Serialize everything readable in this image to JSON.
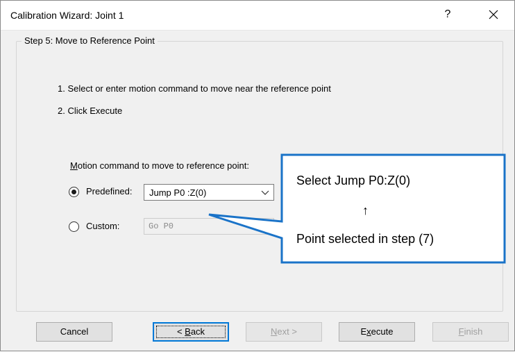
{
  "window": {
    "title": "Calibration Wizard: Joint 1",
    "help_label": "?"
  },
  "group": {
    "title": "Step 5: Move to Reference Point"
  },
  "instructions": [
    "1. Select or enter motion command to move near the reference point",
    "2. Click Execute"
  ],
  "motion": {
    "label_accesskey": "M",
    "label_rest": "otion command to move to reference point:",
    "predefined_label": "Predefined:",
    "predefined_selected": true,
    "predefined_value": "Jump P0 :Z(0)",
    "custom_label": "Custom:",
    "custom_selected": false,
    "custom_value": "Go P0"
  },
  "callout": {
    "line1": "Select Jump P0:Z(0)",
    "arrow": "↑",
    "line2": "Point selected in step (7)",
    "border_color": "#1a73c8"
  },
  "buttons": {
    "cancel": "Cancel",
    "back_pre": "< ",
    "back_key": "B",
    "back_post": "ack",
    "next_key": "N",
    "next_post": "ext >",
    "execute_pre": "E",
    "execute_key": "x",
    "execute_post": "ecute",
    "finish_key": "F",
    "finish_post": "inish"
  },
  "colors": {
    "accent": "#0078d7",
    "disabled_text": "#a0a0a0"
  }
}
